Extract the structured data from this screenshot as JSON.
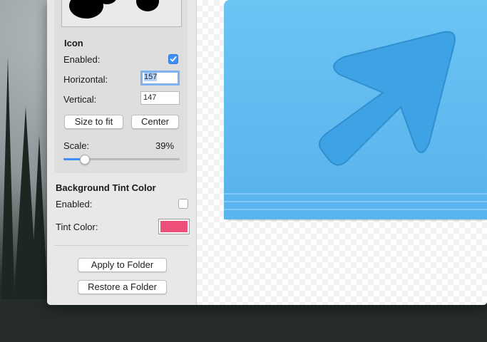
{
  "sidebar": {
    "icon_section": {
      "heading": "Icon",
      "enabled_label": "Enabled:",
      "enabled": true,
      "horizontal_label": "Horizontal:",
      "horizontal_value": "157",
      "vertical_label": "Vertical:",
      "vertical_value": "147",
      "size_to_fit_label": "Size to fit",
      "center_label": "Center",
      "scale_label": "Scale:",
      "scale_value": "39%",
      "scale_fraction": 0.39
    },
    "tint_section": {
      "heading": "Background Tint Color",
      "enabled_label": "Enabled:",
      "enabled": false,
      "tint_label": "Tint Color:",
      "tint_color": "#ee4f78"
    },
    "apply_label": "Apply to Folder",
    "restore_label": "Restore a Folder"
  },
  "canvas": {
    "folder_color": "#5fb8ef",
    "icon": "arrow-icon"
  }
}
